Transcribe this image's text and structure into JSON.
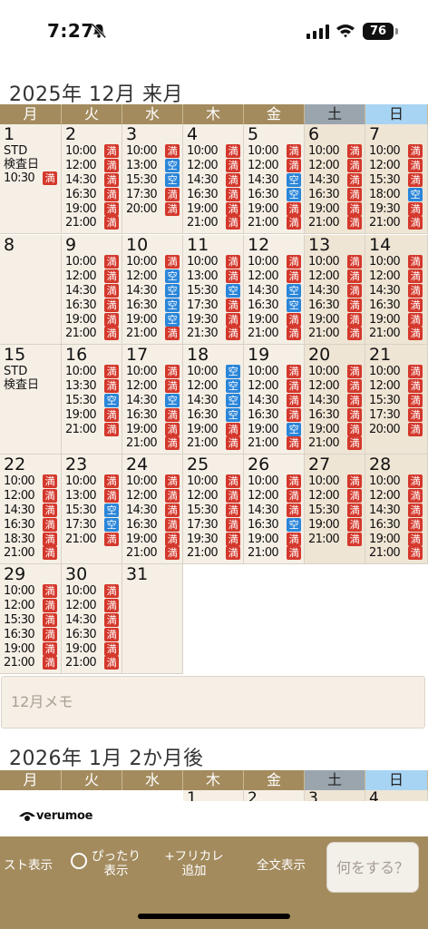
{
  "status_bar": {
    "time": "7:27",
    "battery": "76"
  },
  "weekdays": [
    "月",
    "火",
    "水",
    "木",
    "金",
    "土",
    "日"
  ],
  "december": {
    "title": "2025年 12月 来月",
    "weeks": [
      [
        {
          "day": "1",
          "notes": [
            "STD",
            "検査日"
          ],
          "slots": [
            [
              "10:30",
              "満"
            ]
          ]
        },
        {
          "day": "2",
          "slots": [
            [
              "10:00",
              "満"
            ],
            [
              "12:00",
              "満"
            ],
            [
              "14:30",
              "満"
            ],
            [
              "16:30",
              "満"
            ],
            [
              "19:00",
              "満"
            ],
            [
              "21:00",
              "満"
            ]
          ]
        },
        {
          "day": "3",
          "slots": [
            [
              "10:00",
              "満"
            ],
            [
              "13:00",
              "空"
            ],
            [
              "15:30",
              "空"
            ],
            [
              "17:30",
              "満"
            ],
            [
              "20:00",
              "満"
            ]
          ]
        },
        {
          "day": "4",
          "slots": [
            [
              "10:00",
              "満"
            ],
            [
              "12:00",
              "満"
            ],
            [
              "14:30",
              "満"
            ],
            [
              "16:30",
              "満"
            ],
            [
              "19:00",
              "満"
            ],
            [
              "21:00",
              "満"
            ]
          ]
        },
        {
          "day": "5",
          "slots": [
            [
              "10:00",
              "満"
            ],
            [
              "12:00",
              "満"
            ],
            [
              "14:30",
              "空"
            ],
            [
              "16:30",
              "空"
            ],
            [
              "19:00",
              "満"
            ],
            [
              "21:00",
              "満"
            ]
          ]
        },
        {
          "day": "6",
          "slots": [
            [
              "10:00",
              "満"
            ],
            [
              "12:00",
              "満"
            ],
            [
              "14:30",
              "満"
            ],
            [
              "16:30",
              "満"
            ],
            [
              "19:00",
              "満"
            ],
            [
              "21:00",
              "満"
            ]
          ]
        },
        {
          "day": "7",
          "slots": [
            [
              "10:00",
              "満"
            ],
            [
              "12:00",
              "満"
            ],
            [
              "15:30",
              "満"
            ],
            [
              "18:00",
              "空"
            ],
            [
              "19:30",
              "満"
            ],
            [
              "21:00",
              "満"
            ]
          ]
        }
      ],
      [
        {
          "day": "8",
          "slots": []
        },
        {
          "day": "9",
          "slots": [
            [
              "10:00",
              "満"
            ],
            [
              "12:00",
              "満"
            ],
            [
              "14:30",
              "満"
            ],
            [
              "16:30",
              "満"
            ],
            [
              "19:00",
              "満"
            ],
            [
              "21:00",
              "満"
            ]
          ]
        },
        {
          "day": "10",
          "slots": [
            [
              "10:00",
              "満"
            ],
            [
              "12:00",
              "空"
            ],
            [
              "14:30",
              "空"
            ],
            [
              "16:30",
              "空"
            ],
            [
              "19:00",
              "空"
            ],
            [
              "21:00",
              "満"
            ]
          ]
        },
        {
          "day": "11",
          "slots": [
            [
              "10:00",
              "満"
            ],
            [
              "13:00",
              "満"
            ],
            [
              "15:30",
              "空"
            ],
            [
              "17:30",
              "満"
            ],
            [
              "19:30",
              "満"
            ],
            [
              "21:30",
              "満"
            ]
          ]
        },
        {
          "day": "12",
          "slots": [
            [
              "10:00",
              "満"
            ],
            [
              "12:00",
              "満"
            ],
            [
              "14:30",
              "空"
            ],
            [
              "16:30",
              "空"
            ],
            [
              "19:00",
              "満"
            ],
            [
              "21:00",
              "満"
            ]
          ]
        },
        {
          "day": "13",
          "slots": [
            [
              "10:00",
              "満"
            ],
            [
              "12:00",
              "満"
            ],
            [
              "14:30",
              "満"
            ],
            [
              "16:30",
              "満"
            ],
            [
              "19:00",
              "満"
            ],
            [
              "21:00",
              "満"
            ]
          ]
        },
        {
          "day": "14",
          "slots": [
            [
              "10:00",
              "満"
            ],
            [
              "12:00",
              "満"
            ],
            [
              "14:30",
              "満"
            ],
            [
              "16:30",
              "満"
            ],
            [
              "19:00",
              "満"
            ],
            [
              "21:00",
              "満"
            ]
          ]
        }
      ],
      [
        {
          "day": "15",
          "notes": [
            "STD",
            "検査日"
          ],
          "slots": []
        },
        {
          "day": "16",
          "slots": [
            [
              "10:00",
              "満"
            ],
            [
              "13:30",
              "満"
            ],
            [
              "15:30",
              "空"
            ],
            [
              "19:00",
              "満"
            ],
            [
              "21:00",
              "満"
            ]
          ]
        },
        {
          "day": "17",
          "slots": [
            [
              "10:00",
              "満"
            ],
            [
              "12:00",
              "満"
            ],
            [
              "14:30",
              "空"
            ],
            [
              "16:30",
              "満"
            ],
            [
              "19:00",
              "満"
            ],
            [
              "21:00",
              "満"
            ]
          ]
        },
        {
          "day": "18",
          "slots": [
            [
              "10:00",
              "空"
            ],
            [
              "12:00",
              "空"
            ],
            [
              "14:30",
              "空"
            ],
            [
              "16:30",
              "空"
            ],
            [
              "19:00",
              "満"
            ],
            [
              "21:00",
              "満"
            ]
          ]
        },
        {
          "day": "19",
          "slots": [
            [
              "10:00",
              "満"
            ],
            [
              "12:00",
              "満"
            ],
            [
              "14:30",
              "満"
            ],
            [
              "16:30",
              "満"
            ],
            [
              "19:00",
              "空"
            ],
            [
              "21:00",
              "満"
            ]
          ]
        },
        {
          "day": "20",
          "slots": [
            [
              "10:00",
              "満"
            ],
            [
              "12:00",
              "満"
            ],
            [
              "14:30",
              "満"
            ],
            [
              "16:30",
              "満"
            ],
            [
              "19:00",
              "満"
            ],
            [
              "21:00",
              "満"
            ]
          ]
        },
        {
          "day": "21",
          "slots": [
            [
              "10:00",
              "満"
            ],
            [
              "12:00",
              "満"
            ],
            [
              "15:30",
              "満"
            ],
            [
              "17:30",
              "満"
            ],
            [
              "20:00",
              "満"
            ]
          ]
        }
      ],
      [
        {
          "day": "22",
          "slots": [
            [
              "10:00",
              "満"
            ],
            [
              "12:00",
              "満"
            ],
            [
              "14:30",
              "満"
            ],
            [
              "16:30",
              "満"
            ],
            [
              "18:30",
              "満"
            ],
            [
              "21:00",
              "満"
            ]
          ]
        },
        {
          "day": "23",
          "slots": [
            [
              "10:00",
              "満"
            ],
            [
              "13:00",
              "満"
            ],
            [
              "15:30",
              "空"
            ],
            [
              "17:30",
              "空"
            ],
            [
              "21:00",
              "満"
            ]
          ]
        },
        {
          "day": "24",
          "slots": [
            [
              "10:00",
              "満"
            ],
            [
              "12:00",
              "満"
            ],
            [
              "14:30",
              "満"
            ],
            [
              "16:30",
              "満"
            ],
            [
              "19:00",
              "満"
            ],
            [
              "21:00",
              "満"
            ]
          ]
        },
        {
          "day": "25",
          "slots": [
            [
              "10:00",
              "満"
            ],
            [
              "12:00",
              "満"
            ],
            [
              "15:30",
              "満"
            ],
            [
              "17:30",
              "満"
            ],
            [
              "19:30",
              "満"
            ],
            [
              "21:00",
              "満"
            ]
          ]
        },
        {
          "day": "26",
          "slots": [
            [
              "10:00",
              "満"
            ],
            [
              "12:00",
              "満"
            ],
            [
              "14:30",
              "満"
            ],
            [
              "16:30",
              "空"
            ],
            [
              "19:00",
              "満"
            ],
            [
              "21:00",
              "満"
            ]
          ]
        },
        {
          "day": "27",
          "slots": [
            [
              "10:00",
              "満"
            ],
            [
              "12:00",
              "満"
            ],
            [
              "15:30",
              "満"
            ],
            [
              "19:00",
              "満"
            ],
            [
              "21:00",
              "満"
            ]
          ]
        },
        {
          "day": "28",
          "slots": [
            [
              "10:00",
              "満"
            ],
            [
              "12:00",
              "満"
            ],
            [
              "14:30",
              "満"
            ],
            [
              "16:30",
              "満"
            ],
            [
              "19:00",
              "満"
            ],
            [
              "21:00",
              "満"
            ]
          ]
        }
      ],
      [
        {
          "day": "29",
          "slots": [
            [
              "10:00",
              "満"
            ],
            [
              "12:00",
              "満"
            ],
            [
              "15:30",
              "満"
            ],
            [
              "16:30",
              "満"
            ],
            [
              "19:00",
              "満"
            ],
            [
              "21:00",
              "満"
            ]
          ]
        },
        {
          "day": "30",
          "slots": [
            [
              "10:00",
              "満"
            ],
            [
              "12:00",
              "満"
            ],
            [
              "14:30",
              "満"
            ],
            [
              "16:30",
              "満"
            ],
            [
              "19:00",
              "満"
            ],
            [
              "21:00",
              "満"
            ]
          ]
        },
        {
          "day": "31",
          "slots": []
        }
      ]
    ],
    "memo_placeholder": "12月メモ"
  },
  "january": {
    "title": "2026年 1月 2か月後",
    "visible_days": [
      "1",
      "2",
      "3",
      "4"
    ]
  },
  "banner": {
    "logo_text": "verumoe"
  },
  "toolbar": {
    "list_label": "スト表示",
    "fit_label_1": "ぴったり",
    "fit_label_2": "表示",
    "add_label_1": "+フリカレ",
    "add_label_2": "追加",
    "fulltext_label": "全文表示",
    "prompt_label": "何をする？"
  },
  "colors": {
    "header": "#a38b5e",
    "full": "#d4382c",
    "open": "#2b86d9",
    "saturday": "#9aa5ae",
    "sunday": "#a8d4f3"
  }
}
